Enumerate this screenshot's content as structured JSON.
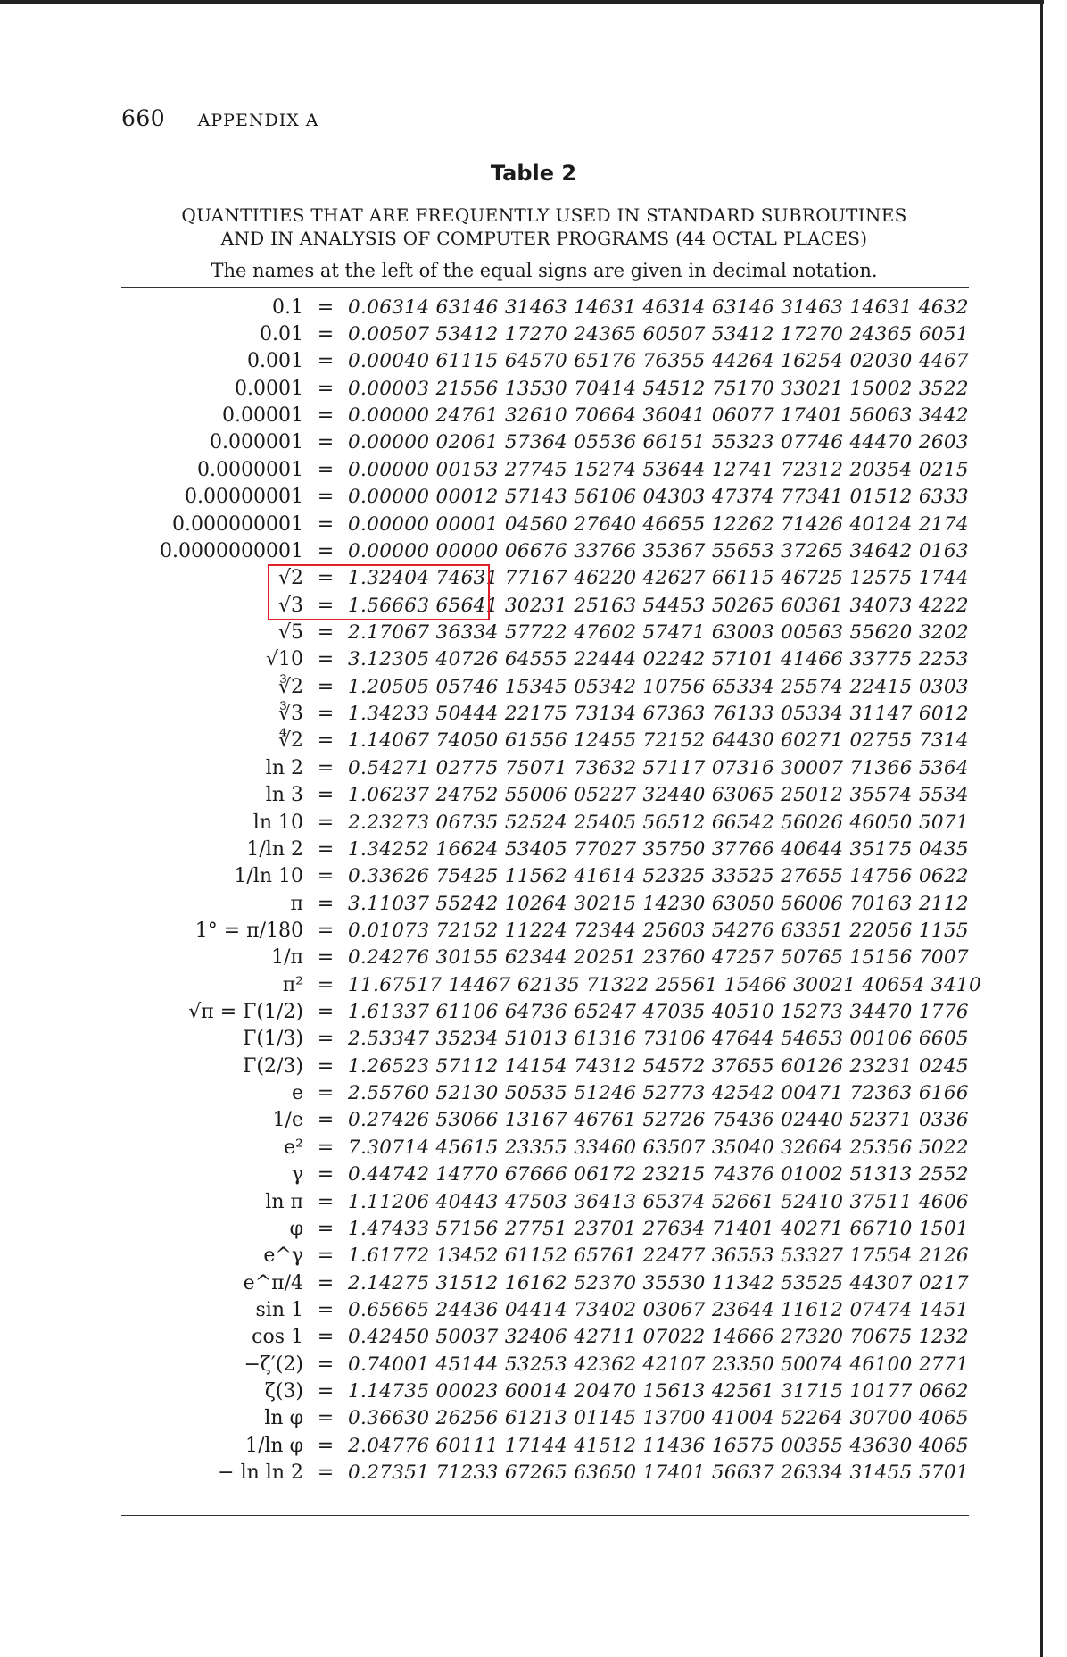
{
  "header": {
    "page_number": "660",
    "section": "APPENDIX A"
  },
  "table_title": "Table 2",
  "caption_line1": "QUANTITIES THAT ARE FREQUENTLY USED IN STANDARD SUBROUTINES",
  "caption_line2": "AND IN ANALYSIS OF COMPUTER PROGRAMS (44 OCTAL PLACES)",
  "note": "The names at the left of the equal signs are given in decimal notation.",
  "highlight_color": "#e0202a",
  "rows": [
    {
      "name": "0.1",
      "eq": "=",
      "value": "0.06314 63146 31463 14631 46314 63146 31463 14631 4632"
    },
    {
      "name": "0.01",
      "eq": "=",
      "value": "0.00507 53412 17270 24365 60507 53412 17270 24365 6051"
    },
    {
      "name": "0.001",
      "eq": "=",
      "value": "0.00040 61115 64570 65176 76355 44264 16254 02030 4467"
    },
    {
      "name": "0.0001",
      "eq": "=",
      "value": "0.00003 21556 13530 70414 54512 75170 33021 15002 3522"
    },
    {
      "name": "0.00001",
      "eq": "=",
      "value": "0.00000 24761 32610 70664 36041 06077 17401 56063 3442"
    },
    {
      "name": "0.000001",
      "eq": "=",
      "value": "0.00000 02061 57364 05536 66151 55323 07746 44470 2603"
    },
    {
      "name": "0.0000001",
      "eq": "=",
      "value": "0.00000 00153 27745 15274 53644 12741 72312 20354 0215"
    },
    {
      "name": "0.00000001",
      "eq": "=",
      "value": "0.00000 00012 57143 56106 04303 47374 77341 01512 6333"
    },
    {
      "name": "0.000000001",
      "eq": "=",
      "value": "0.00000 00001 04560 27640 46655 12262 71426 40124 2174"
    },
    {
      "name": "0.0000000001",
      "eq": "=",
      "value": "0.00000 00000 06676 33766 35367 55653 37265 34642 0163"
    },
    {
      "name": "√2",
      "eq": "=",
      "value": "1.32404 74631 77167 46220 42627 66115 46725 12575 1744"
    },
    {
      "name": "√3",
      "eq": "=",
      "value": "1.56663 65641 30231 25163 54453 50265 60361 34073 4222"
    },
    {
      "name": "√5",
      "eq": "=",
      "value": "2.17067 36334 57722 47602 57471 63003 00563 55620 3202"
    },
    {
      "name": "√10",
      "eq": "=",
      "value": "3.12305 40726 64555 22444 02242 57101 41466 33775 2253"
    },
    {
      "name": "∛2",
      "eq": "=",
      "value": "1.20505 05746 15345 05342 10756 65334 25574 22415 0303"
    },
    {
      "name": "∛3",
      "eq": "=",
      "value": "1.34233 50444 22175 73134 67363 76133 05334 31147 6012"
    },
    {
      "name": "∜2",
      "eq": "=",
      "value": "1.14067 74050 61556 12455 72152 64430 60271 02755 7314"
    },
    {
      "name": "ln 2",
      "eq": "=",
      "value": "0.54271 02775 75071 73632 57117 07316 30007 71366 5364"
    },
    {
      "name": "ln 3",
      "eq": "=",
      "value": "1.06237 24752 55006 05227 32440 63065 25012 35574 5534"
    },
    {
      "name": "ln 10",
      "eq": "=",
      "value": "2.23273 06735 52524 25405 56512 66542 56026 46050 5071"
    },
    {
      "name": "1/ln 2",
      "eq": "=",
      "value": "1.34252 16624 53405 77027 35750 37766 40644 35175 0435"
    },
    {
      "name": "1/ln 10",
      "eq": "=",
      "value": "0.33626 75425 11562 41614 52325 33525 27655 14756 0622"
    },
    {
      "name": "π",
      "eq": "=",
      "value": "3.11037 55242 10264 30215 14230 63050 56006 70163 2112"
    },
    {
      "name": "1° = π/180",
      "eq": "=",
      "value": "0.01073 72152 11224 72344 25603 54276 63351 22056 1155"
    },
    {
      "name": "1/π",
      "eq": "=",
      "value": "0.24276 30155 62344 20251 23760 47257 50765 15156 7007"
    },
    {
      "name": "π²",
      "eq": "=",
      "value": "11.67517 14467 62135 71322 25561 15466 30021 40654 3410"
    },
    {
      "name": "√π = Γ(1/2)",
      "eq": "=",
      "value": "1.61337 61106 64736 65247 47035 40510 15273 34470 1776"
    },
    {
      "name": "Γ(1/3)",
      "eq": "=",
      "value": "2.53347 35234 51013 61316 73106 47644 54653 00106 6605"
    },
    {
      "name": "Γ(2/3)",
      "eq": "=",
      "value": "1.26523 57112 14154 74312 54572 37655 60126 23231 0245"
    },
    {
      "name": "e",
      "eq": "=",
      "value": "2.55760 52130 50535 51246 52773 42542 00471 72363 6166"
    },
    {
      "name": "1/e",
      "eq": "=",
      "value": "0.27426 53066 13167 46761 52726 75436 02440 52371 0336"
    },
    {
      "name": "e²",
      "eq": "=",
      "value": "7.30714 45615 23355 33460 63507 35040 32664 25356 5022"
    },
    {
      "name": "γ",
      "eq": "=",
      "value": "0.44742 14770 67666 06172 23215 74376 01002 51313 2552"
    },
    {
      "name": "ln π",
      "eq": "=",
      "value": "1.11206 40443 47503 36413 65374 52661 52410 37511 4606"
    },
    {
      "name": "φ",
      "eq": "=",
      "value": "1.47433 57156 27751 23701 27634 71401 40271 66710 1501"
    },
    {
      "name": "e^γ",
      "eq": "=",
      "value": "1.61772 13452 61152 65761 22477 36553 53327 17554 2126"
    },
    {
      "name": "e^π/4",
      "eq": "=",
      "value": "2.14275 31512 16162 52370 35530 11342 53525 44307 0217"
    },
    {
      "name": "sin 1",
      "eq": "=",
      "value": "0.65665 24436 04414 73402 03067 23644 11612 07474 1451"
    },
    {
      "name": "cos 1",
      "eq": "=",
      "value": "0.42450 50037 32406 42711 07022 14666 27320 70675 1232"
    },
    {
      "name": "−ζ′(2)",
      "eq": "=",
      "value": "0.74001 45144 53253 42362 42107 23350 50074 46100 2771"
    },
    {
      "name": "ζ(3)",
      "eq": "=",
      "value": "1.14735 00023 60014 20470 15613 42561 31715 10177 0662"
    },
    {
      "name": "ln φ",
      "eq": "=",
      "value": "0.36630 26256 61213 01145 13700 41004 52264 30700 4065"
    },
    {
      "name": "1/ln φ",
      "eq": "=",
      "value": "2.04776 60111 17144 41512 11436 16575 00355 43630 4065"
    },
    {
      "name": "− ln ln 2",
      "eq": "=",
      "value": "0.27351 71233 67265 63650 17401 56637 26334 31455 5701"
    }
  ]
}
